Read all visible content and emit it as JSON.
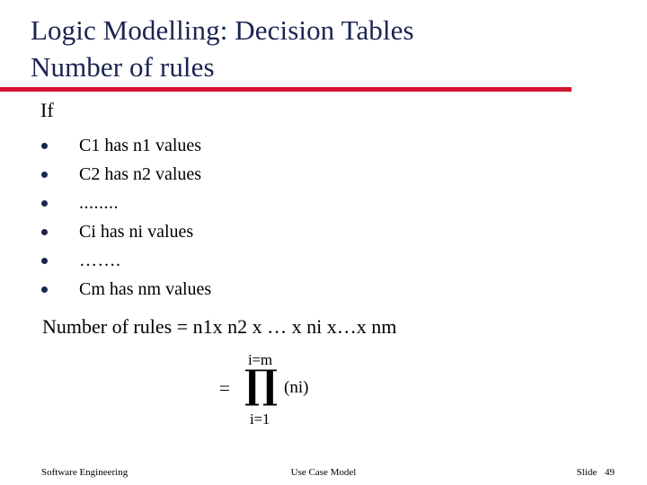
{
  "slide": {
    "title": {
      "line1": "Logic Modelling: Decision Tables",
      "line2": "Number of rules"
    },
    "accent_color": "#d61331",
    "title_color": "#1a2450",
    "intro": "If",
    "bullets": [
      {
        "label": "C1 has n1 values"
      },
      {
        "label": "C2 has n2 values"
      },
      {
        "label": "........"
      },
      {
        "label": "Ci has ni values"
      },
      {
        "label": "……."
      },
      {
        "label": "Cm has nm values"
      }
    ],
    "formula": {
      "line": "Number of rules = n1x n2 x … x ni x…x nm",
      "equals": "=",
      "upper_limit": "i=m",
      "product_symbol": "∏",
      "lower_limit": "i=1",
      "argument": "(ni)"
    },
    "footer": {
      "left": "Software Engineering",
      "center": "Use Case Model",
      "right_label": "Slide",
      "right_number": "49"
    }
  }
}
